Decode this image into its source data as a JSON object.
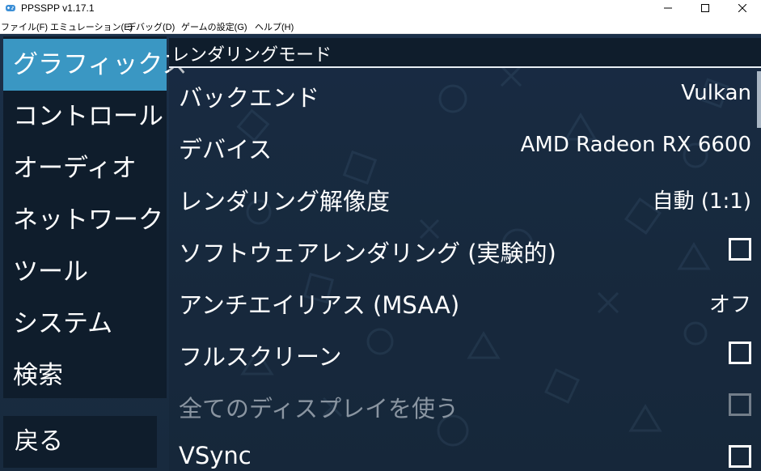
{
  "window": {
    "title": "PPSSPP v1.17.1"
  },
  "menubar": {
    "items": [
      "ファイル(F)",
      "エミュレーション(E)",
      "デバッグ(D)",
      "ゲームの設定(G)",
      "ヘルプ(H)"
    ]
  },
  "sidebar": {
    "items": [
      "グラフィックス",
      "コントロール",
      "オーディオ",
      "ネットワーク",
      "ツール",
      "システム",
      "検索"
    ],
    "active_index": 0,
    "back_label": "戻る"
  },
  "section": {
    "title": "レンダリングモード"
  },
  "settings": [
    {
      "label": "バックエンド",
      "value": "Vulkan"
    },
    {
      "label": "デバイス",
      "value": "AMD Radeon RX 6600"
    },
    {
      "label": "レンダリング解像度",
      "value": "自動 (1:1)"
    },
    {
      "label": "ソフトウェアレンダリング (実験的)",
      "checked": false
    },
    {
      "label": "アンチエイリアス (MSAA)",
      "value": "オフ"
    },
    {
      "label": "フルスクリーン",
      "checked": false
    },
    {
      "label": "全てのディスプレイを使う",
      "checked": false,
      "disabled": true
    },
    {
      "label": "VSync",
      "checked": false
    }
  ],
  "colors": {
    "accent": "#3a97c3",
    "panel": "#0f1d2c",
    "background": "#1b2f45",
    "disabled_text": "#8a95a1"
  },
  "icons": {
    "app": "ppsspp-app-icon",
    "minimize": "minimize-icon",
    "maximize": "maximize-icon",
    "close": "close-icon"
  }
}
